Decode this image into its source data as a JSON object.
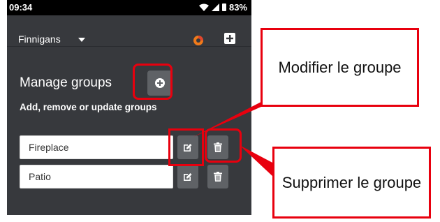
{
  "status_bar": {
    "time": "09:34",
    "battery": "83%"
  },
  "header": {
    "account": "Finnigans"
  },
  "page": {
    "title": "Manage groups",
    "subtitle": "Add, remove or update groups"
  },
  "groups": [
    {
      "name": "Fireplace"
    },
    {
      "name": "Patio"
    }
  ],
  "annotations": {
    "edit_group": "Modifier le groupe",
    "delete_group": "Supprimer le groupe"
  },
  "colors": {
    "background": "#37393d",
    "button": "#5f6266",
    "highlight": "#e8000e",
    "logo_orange": "#f07a1a"
  },
  "icons": {
    "edit": "edit-icon",
    "delete": "trash-icon",
    "add": "plus-circle-icon"
  }
}
